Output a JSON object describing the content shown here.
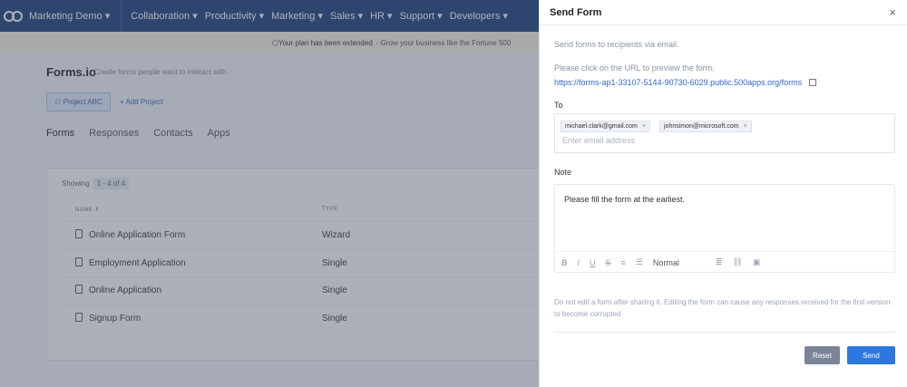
{
  "topbar": {
    "workspace": "Marketing Demo",
    "menu": [
      "Collaboration",
      "Productivity",
      "Marketing",
      "Sales",
      "HR",
      "Support",
      "Developers"
    ]
  },
  "notice": {
    "text": "Your plan has been extended",
    "subtext": "- Grow your business like the Fortune 500"
  },
  "page": {
    "title": "Forms.io",
    "subtitle": "Create forms people want to interact with.",
    "project_label": "Project ABC",
    "add_project_label": "+ Add Project"
  },
  "tabs": [
    "Forms",
    "Responses",
    "Contacts",
    "Apps"
  ],
  "table": {
    "showing_label": "Showing",
    "showing_range": "1 - 4 of 4",
    "col_name": "NAME",
    "col_type": "TYPE",
    "rows": [
      {
        "name": "Online Application Form",
        "type": "Wizard"
      },
      {
        "name": "Employment Application",
        "type": "Single"
      },
      {
        "name": "Online Application",
        "type": "Single"
      },
      {
        "name": "Signup Form",
        "type": "Single"
      }
    ]
  },
  "send_form": {
    "title": "Send Form",
    "close_glyph": "×",
    "intro": "Send forms to recipients via email.",
    "preview_text": "Please click on the URL to preview the form.",
    "url": "https://forms-ap1-33107-5144-90730-6029.public.500apps.org/forms",
    "to_label": "To",
    "recipients": [
      "michael.clark@gmail.com",
      "johnsimon@microsoft.com"
    ],
    "email_placeholder": "Enter email address",
    "note_label": "Note",
    "note_text": "Please fill the form at the earliest.",
    "format_select": "Normal",
    "warning": "Do not edit a form after sharing it. Editing the form can cause any responses received for the first version to become corrupted",
    "reset_label": "Reset",
    "send_label": "Send"
  }
}
